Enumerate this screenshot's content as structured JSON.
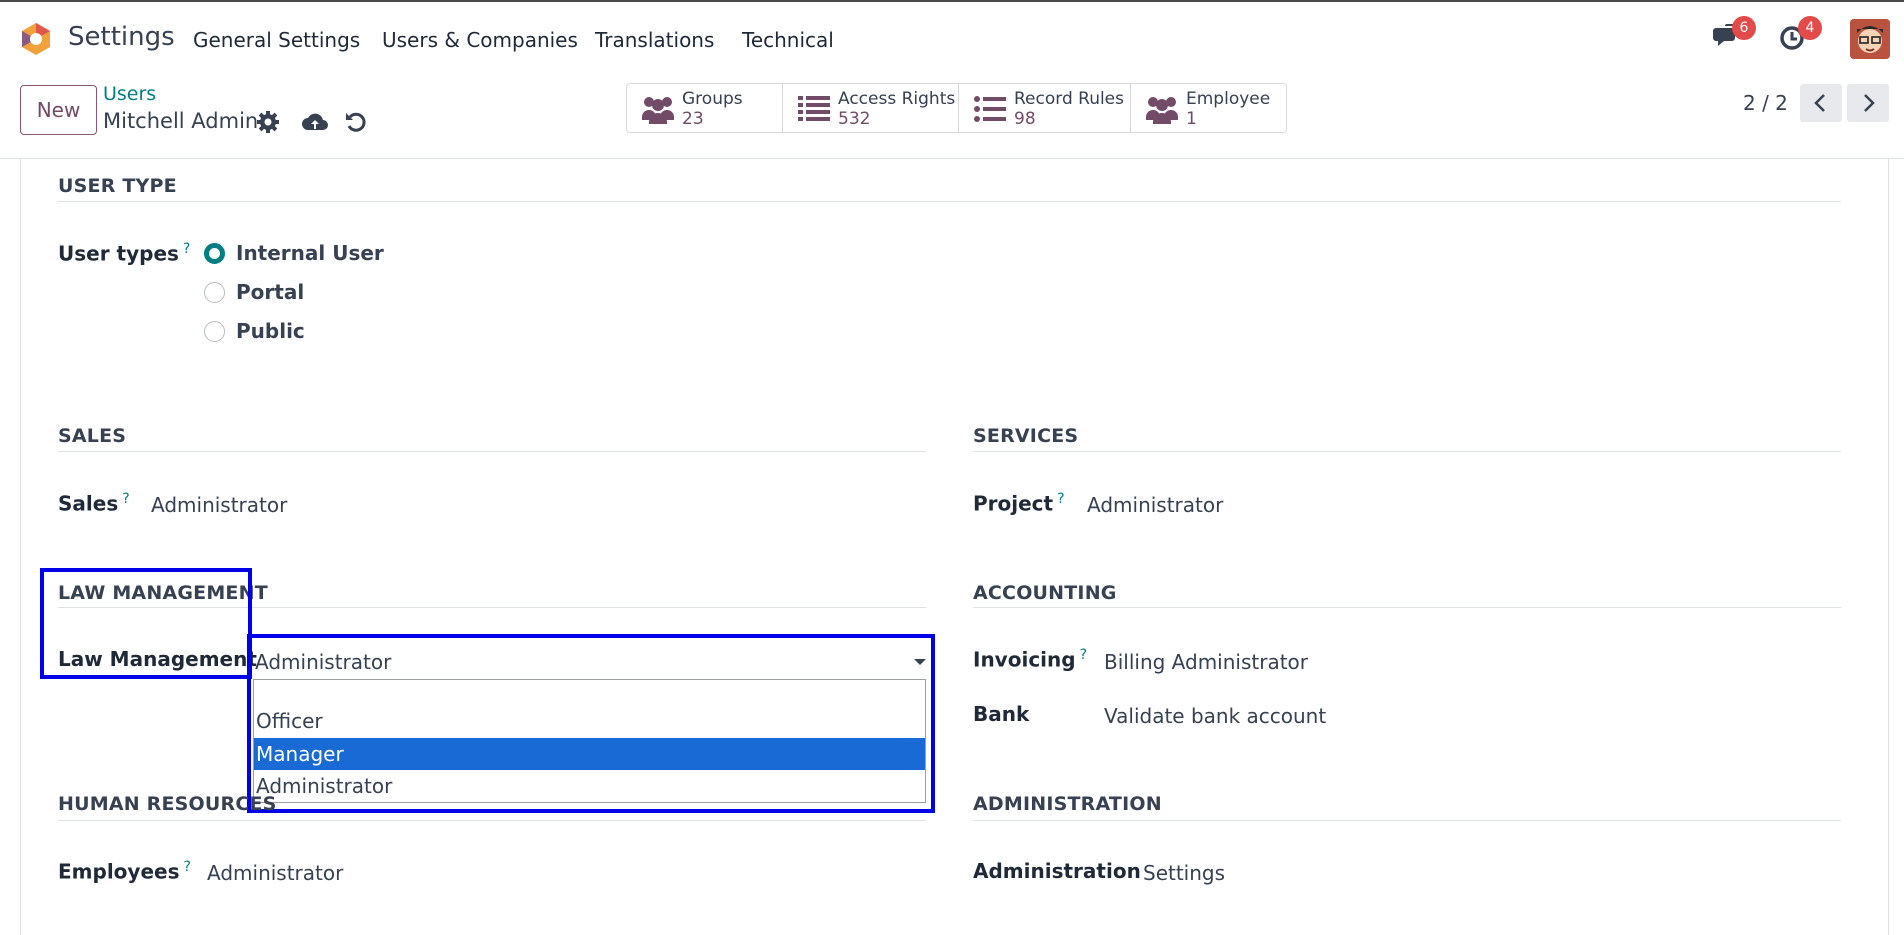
{
  "app": {
    "title": "Settings"
  },
  "menu": [
    "General Settings",
    "Users & Companies",
    "Translations",
    "Technical"
  ],
  "systray": {
    "messages_count": "6",
    "activities_count": "4"
  },
  "control_panel": {
    "new_label": "New",
    "breadcrumb": "Users",
    "record_name": "Mitchell Admin",
    "pager": "2 / 2"
  },
  "smart_buttons": [
    {
      "label": "Groups",
      "value": "23",
      "icon": "users-icon"
    },
    {
      "label": "Access Rights",
      "value": "532",
      "icon": "list-icon"
    },
    {
      "label": "Record Rules",
      "value": "98",
      "icon": "list-icon"
    },
    {
      "label": "Employee",
      "value": "1",
      "icon": "users-icon"
    }
  ],
  "form": {
    "user_type": {
      "title": "USER TYPE",
      "label": "User types",
      "help": "?",
      "options": [
        "Internal User",
        "Portal",
        "Public"
      ],
      "selected": "Internal User"
    },
    "sales": {
      "title": "SALES",
      "label": "Sales",
      "help": "?",
      "value": "Administrator"
    },
    "services": {
      "title": "SERVICES",
      "label": "Project",
      "help": "?",
      "value": "Administrator"
    },
    "law": {
      "title": "LAW MANAGEMENT",
      "label": "Law Management",
      "value": "Administrator",
      "options": [
        "",
        "Officer",
        "Manager",
        "Administrator"
      ],
      "highlighted": "Manager"
    },
    "accounting": {
      "title": "ACCOUNTING",
      "invoicing_label": "Invoicing",
      "invoicing_help": "?",
      "invoicing_value": "Billing Administrator",
      "bank_label": "Bank",
      "bank_value": "Validate bank account"
    },
    "hr": {
      "title": "HUMAN RESOURCES",
      "label": "Employees",
      "help": "?",
      "value": "Administrator"
    },
    "administration": {
      "title": "ADMINISTRATION",
      "label": "Administration",
      "value": "Settings"
    }
  },
  "colors": {
    "brand": "#714b67",
    "teal": "#017e84",
    "highlight_border": "#0000e6",
    "dropdown_selected": "#1a6ad6",
    "badge": "#e34a4a"
  }
}
